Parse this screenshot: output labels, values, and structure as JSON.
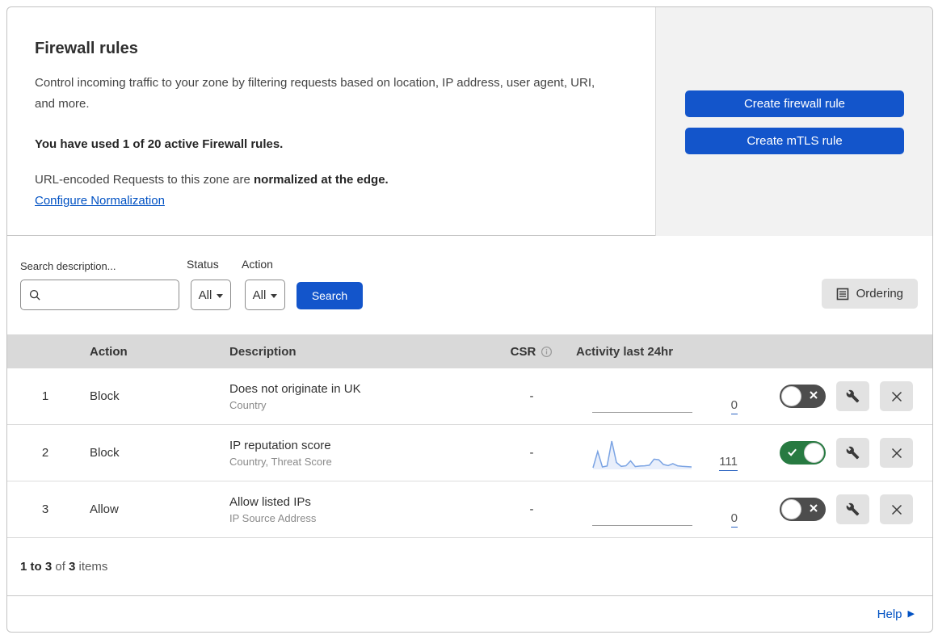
{
  "header": {
    "title": "Firewall rules",
    "description": "Control incoming traffic to your zone by filtering requests based on location, IP address, user agent, URI, and more.",
    "usage": "You have used 1 of 20 active Firewall rules.",
    "normalization_prefix": "URL-encoded Requests to this zone are ",
    "normalization_bold": "normalized at the edge.",
    "normalization_link": "Configure Normalization",
    "buttons": [
      {
        "label": "Create firewall rule"
      },
      {
        "label": "Create mTLS rule"
      }
    ]
  },
  "filters": {
    "search_label": "Search description...",
    "search_value": "",
    "status_label": "Status",
    "status_value": "All",
    "action_label": "Action",
    "action_value": "All",
    "search_button": "Search",
    "ordering_button": "Ordering"
  },
  "table": {
    "headers": {
      "action": "Action",
      "description": "Description",
      "csr": "CSR",
      "activity": "Activity last 24hr"
    },
    "rows": [
      {
        "num": "1",
        "action": "Block",
        "title": "Does not originate in UK",
        "subtitle": "Country",
        "csr": "-",
        "count": "0",
        "enabled": false,
        "sparkline": []
      },
      {
        "num": "2",
        "action": "Block",
        "title": "IP reputation score",
        "subtitle": "Country, Threat Score",
        "csr": "-",
        "count": "111",
        "enabled": true,
        "sparkline": [
          3,
          62,
          6,
          9,
          100,
          22,
          8,
          10,
          28,
          7,
          9,
          10,
          12,
          34,
          32,
          15,
          11,
          18,
          10,
          8,
          7,
          6
        ]
      },
      {
        "num": "3",
        "action": "Allow",
        "title": "Allow listed IPs",
        "subtitle": "IP Source Address",
        "csr": "-",
        "count": "0",
        "enabled": false,
        "sparkline": []
      }
    ]
  },
  "footer": {
    "range": "1 to 3",
    "of": " of ",
    "total": "3",
    "items": " items",
    "help": "Help"
  },
  "colors": {
    "accent_blue": "#1355cb",
    "link_blue": "#0051c3",
    "toggle_on_green": "#277a41",
    "toggle_off_grey": "#4d4d4d",
    "sparkline_line": "#7aa3e3",
    "sparkline_fill": "#e9effb",
    "table_header_bg": "#d9d9d9"
  }
}
